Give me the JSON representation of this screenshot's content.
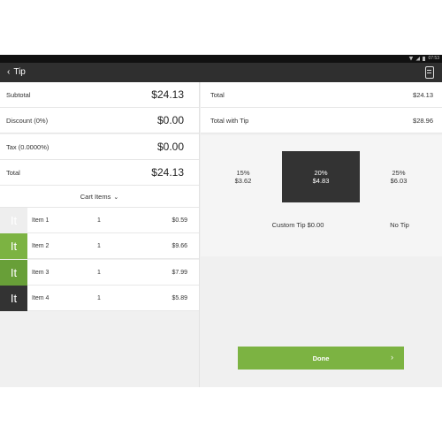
{
  "status_bar": {
    "time": "07:53"
  },
  "header": {
    "back_label": "Tip",
    "back_icon": "chevron-left-icon",
    "printer_icon": "printer-icon"
  },
  "summary": [
    {
      "label": "Subtotal",
      "value": "$24.13"
    },
    {
      "label": "Discount (0%)",
      "value": "$0.00"
    },
    {
      "label": "Tax (0.0000%)",
      "value": "$0.00"
    },
    {
      "label": "Total",
      "value": "$24.13"
    }
  ],
  "cart": {
    "toggle_label": "Cart Items",
    "items": [
      {
        "thumb": "It",
        "thumb_color": "#eeeeee",
        "name": "Item 1",
        "qty": "1",
        "price": "$0.59"
      },
      {
        "thumb": "It",
        "thumb_color": "#7cb342",
        "name": "Item 2",
        "qty": "1",
        "price": "$9.66"
      },
      {
        "thumb": "It",
        "thumb_color": "#689f38",
        "name": "Item 3",
        "qty": "1",
        "price": "$7.99"
      },
      {
        "thumb": "It",
        "thumb_color": "#333333",
        "name": "Item 4",
        "qty": "1",
        "price": "$5.89"
      }
    ]
  },
  "totals": [
    {
      "label": "Total",
      "value": "$24.13"
    },
    {
      "label": "Total with Tip",
      "value": "$28.96"
    }
  ],
  "tip": {
    "options": [
      {
        "pct": "15%",
        "amount": "$3.62",
        "selected": false
      },
      {
        "pct": "20%",
        "amount": "$4.83",
        "selected": true
      },
      {
        "pct": "25%",
        "amount": "$6.03",
        "selected": false
      }
    ],
    "custom_label": "Custom Tip $0.00",
    "no_tip_label": "No Tip"
  },
  "done_button": {
    "label": "Done"
  },
  "colors": {
    "accent": "#7cb342",
    "dark": "#333333",
    "appbar": "#2f2f2f"
  }
}
